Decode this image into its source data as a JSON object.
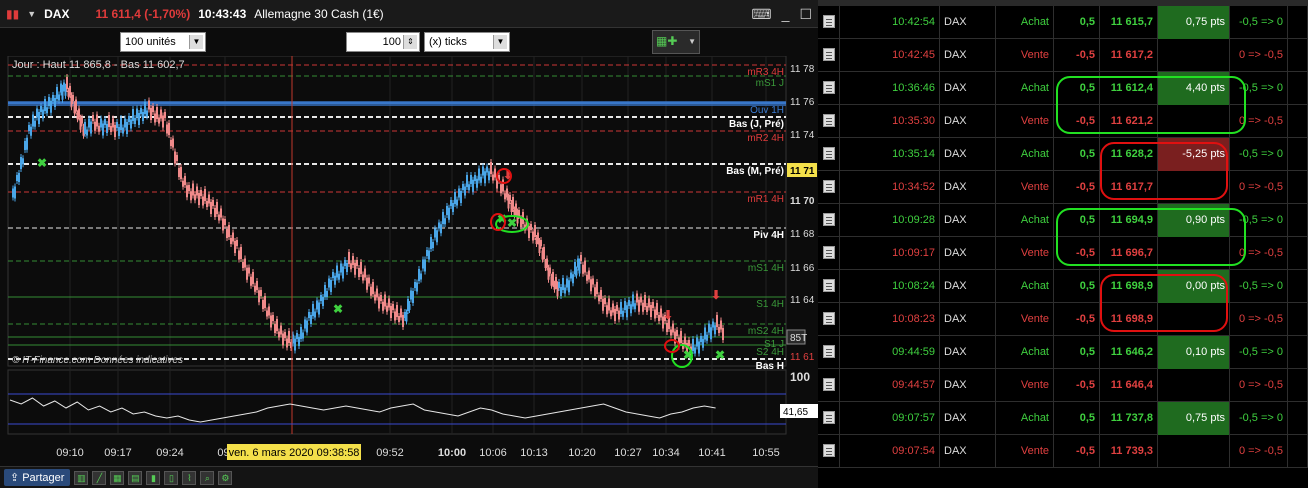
{
  "window": {
    "symbol": "DAX",
    "price_change": "11 611,4 (-1,70%)",
    "time": "10:43:43",
    "instrument": "Allemagne 30 Cash (1€)"
  },
  "toolbar": {
    "units": "100 unités",
    "tick_value": "100",
    "tick_unit": "(x) ticks"
  },
  "chart": {
    "info_text": "Jour : Haut 11 865,8 - Bas 11 602,7",
    "watermark": "© IT-Finance.com  Données indicatives",
    "crosshair_time": "ven. 6 mars 2020 09:38:58",
    "current_price_tag": "11 61",
    "indicator_value": "41,65",
    "indicator_top": "100",
    "price_axis": [
      "11 78",
      "11 76",
      "11 74",
      "11 71",
      "11 70",
      "11 68",
      "11 66",
      "11 64",
      "85T",
      "11 61"
    ],
    "time_axis": [
      "09:10",
      "09:17",
      "09:24",
      "09:",
      "09:52",
      "10:00",
      "10:06",
      "10:13",
      "10:20",
      "10:27",
      "10:34",
      "10:41",
      "10:55"
    ],
    "levels": [
      {
        "label": "mR3 4H",
        "color": "#e03b3b",
        "style": "dash"
      },
      {
        "label": "mS1 J",
        "color": "#3a9a3a",
        "style": "dash"
      },
      {
        "label": "Ouv 1H",
        "color": "#3a7ad0",
        "style": "solid"
      },
      {
        "label": "Bas (J, Pré)",
        "color": "#ffffff",
        "style": "dash"
      },
      {
        "label": "mR2 4H",
        "color": "#e03b3b",
        "style": "dash"
      },
      {
        "label": "Bas (M, Pré)",
        "color": "#ffffff",
        "style": "dash"
      },
      {
        "label": "mR1 4H",
        "color": "#e03b3b",
        "style": "dash"
      },
      {
        "label": "Piv 4H",
        "color": "#ffffff",
        "style": "dash"
      },
      {
        "label": "mS1 4H",
        "color": "#3a9a3a",
        "style": "dash"
      },
      {
        "label": "S1 4H",
        "color": "#3a9a3a",
        "style": "solid"
      },
      {
        "label": "mS2 4H",
        "color": "#3a9a3a",
        "style": "dash"
      },
      {
        "label": "S1 J",
        "color": "#3a9a3a",
        "style": "solid"
      },
      {
        "label": "S2 4H",
        "color": "#3a9a3a",
        "style": "solid"
      },
      {
        "label": "Bas H",
        "color": "#ffffff",
        "style": "dash"
      }
    ]
  },
  "statusbar": {
    "share_label": "Partager"
  },
  "trades": [
    {
      "time": "10:42:54",
      "symbol": "DAX",
      "side": "Achat",
      "qty": "0,5",
      "price": "11 615,7",
      "pnl": "0,75 pts",
      "pos": "-0,5 => 0"
    },
    {
      "time": "10:42:45",
      "symbol": "DAX",
      "side": "Vente",
      "qty": "-0,5",
      "price": "11 617,2",
      "pnl": "",
      "pos": "0 => -0,5"
    },
    {
      "time": "10:36:46",
      "symbol": "DAX",
      "side": "Achat",
      "qty": "0,5",
      "price": "11 612,4",
      "pnl": "4,40 pts",
      "pos": "-0,5 => 0"
    },
    {
      "time": "10:35:30",
      "symbol": "DAX",
      "side": "Vente",
      "qty": "-0,5",
      "price": "11 621,2",
      "pnl": "",
      "pos": "0 => -0,5"
    },
    {
      "time": "10:35:14",
      "symbol": "DAX",
      "side": "Achat",
      "qty": "0,5",
      "price": "11 628,2",
      "pnl": "-5,25 pts",
      "pos": "-0,5 => 0"
    },
    {
      "time": "10:34:52",
      "symbol": "DAX",
      "side": "Vente",
      "qty": "-0,5",
      "price": "11 617,7",
      "pnl": "",
      "pos": "0 => -0,5"
    },
    {
      "time": "10:09:28",
      "symbol": "DAX",
      "side": "Achat",
      "qty": "0,5",
      "price": "11 694,9",
      "pnl": "0,90 pts",
      "pos": "-0,5 => 0"
    },
    {
      "time": "10:09:17",
      "symbol": "DAX",
      "side": "Vente",
      "qty": "-0,5",
      "price": "11 696,7",
      "pnl": "",
      "pos": "0 => -0,5"
    },
    {
      "time": "10:08:24",
      "symbol": "DAX",
      "side": "Achat",
      "qty": "0,5",
      "price": "11 698,9",
      "pnl": "0,00 pts",
      "pos": "-0,5 => 0"
    },
    {
      "time": "10:08:23",
      "symbol": "DAX",
      "side": "Vente",
      "qty": "-0,5",
      "price": "11 698,9",
      "pnl": "",
      "pos": "0 => -0,5"
    },
    {
      "time": "09:44:59",
      "symbol": "DAX",
      "side": "Achat",
      "qty": "0,5",
      "price": "11 646,2",
      "pnl": "0,10 pts",
      "pos": "-0,5 => 0"
    },
    {
      "time": "09:44:57",
      "symbol": "DAX",
      "side": "Vente",
      "qty": "-0,5",
      "price": "11 646,4",
      "pnl": "",
      "pos": "0 => -0,5"
    },
    {
      "time": "09:07:57",
      "symbol": "DAX",
      "side": "Achat",
      "qty": "0,5",
      "price": "11 737,8",
      "pnl": "0,75 pts",
      "pos": "-0,5 => 0"
    },
    {
      "time": "09:07:54",
      "symbol": "DAX",
      "side": "Vente",
      "qty": "-0,5",
      "price": "11 739,3",
      "pnl": "",
      "pos": "0 => -0,5"
    }
  ],
  "colors": {
    "buy": "#3fd03f",
    "sell": "#e04040",
    "gain_bg": "#1f6b1f",
    "loss_bg": "#7a1f1f",
    "annot_green": "#22e022",
    "annot_red": "#e01010"
  }
}
